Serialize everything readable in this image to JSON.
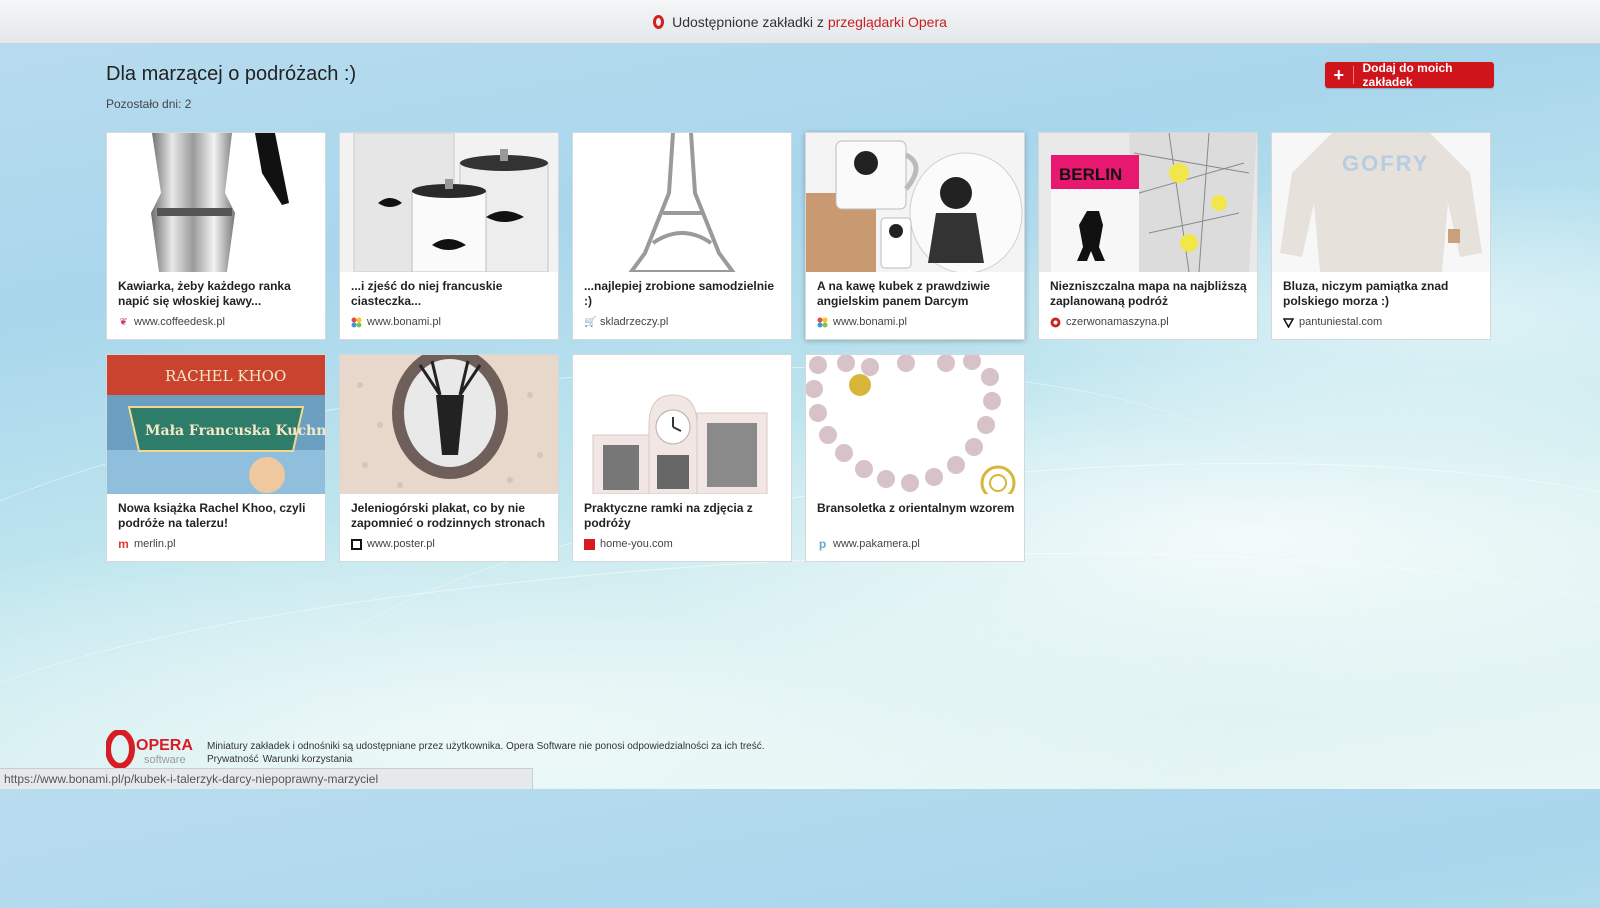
{
  "topbar": {
    "text": "Udostępnione zakładki z",
    "link": "przeglądarki Opera"
  },
  "header": {
    "title": "Dla marzącej o podróżach :)",
    "subtitle": "Pozostało dni: 2",
    "add_button": "Dodaj do moich zakładek"
  },
  "cards": [
    {
      "title": "Kawiarka, żeby każdego ranka napić się włoskiej kawy...",
      "site": "www.coffeedesk.pl"
    },
    {
      "title": "...i zjeść do niej francuskie ciasteczka...",
      "site": "www.bonami.pl"
    },
    {
      "title": "...najlepiej zrobione samodzielnie :)",
      "site": "skladrzeczy.pl"
    },
    {
      "title": "A na kawę kubek z prawdziwie angielskim panem Darcym",
      "site": "www.bonami.pl"
    },
    {
      "title": "Niezniszczalna mapa na najbliższą zaplanowaną podróż",
      "site": "czerwonamaszyna.pl"
    },
    {
      "title": "Bluza, niczym pamiątka znad polskiego morza :)",
      "site": "pantuniestal.com"
    },
    {
      "title": "Nowa książka Rachel Khoo, czyli podróże na talerzu!",
      "site": "merlin.pl"
    },
    {
      "title": "Jeleniogórski plakat, co by nie zapomnieć o rodzinnych stronach",
      "site": "www.poster.pl"
    },
    {
      "title": "Praktyczne ramki na zdjęcia z podróży",
      "site": "home-you.com"
    },
    {
      "title": "Bransoletka z orientalnym wzorem",
      "site": "www.pakamera.pl"
    }
  ],
  "thumb_text": {
    "berlin": "BERLIN",
    "gofry": "GOFRY",
    "khoo_top": "RACHEL KHOO",
    "khoo_book": "Mała Francuska Kuchnia"
  },
  "footer": {
    "logo_main": "OPERA",
    "logo_sub": "software",
    "disclaimer": "Miniatury zakładek i odnośniki są udostępniane przez użytkownika. Opera Software nie ponosi odpowiedzialności za ich treść.",
    "privacy": "Prywatność",
    "terms": "Warunki korzystania"
  },
  "statusbar": {
    "url": "https://www.bonami.pl/p/kubek-i-talerzyk-darcy-niepoprawny-marzyciel"
  },
  "colors": {
    "accent": "#d0141b",
    "opera_red": "#d81c23"
  }
}
